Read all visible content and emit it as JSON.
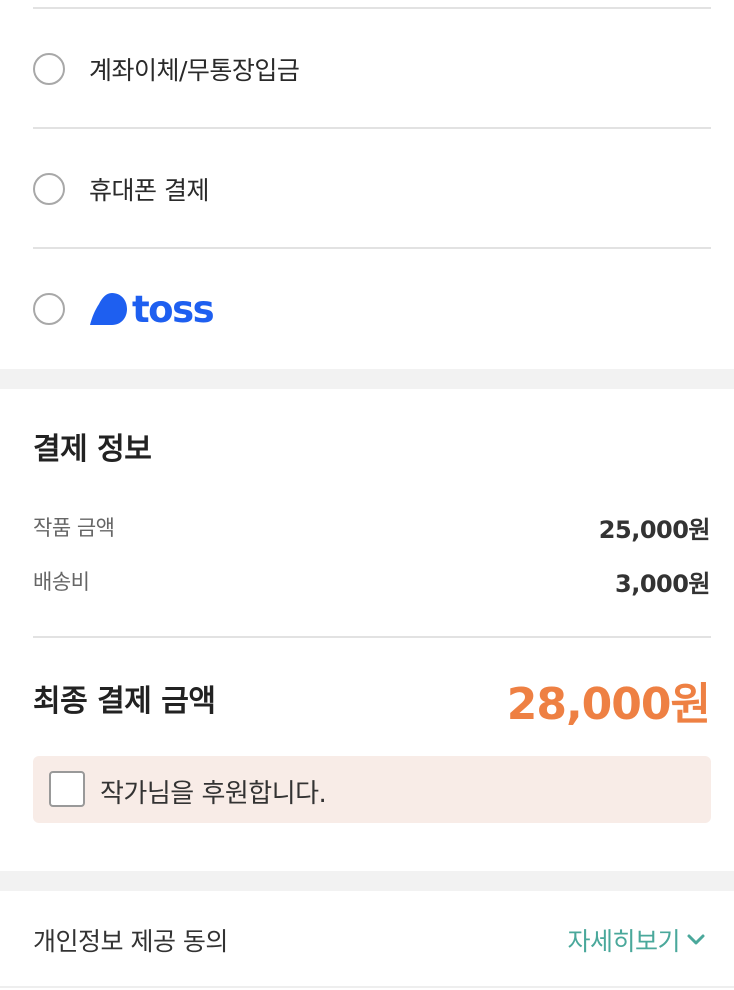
{
  "payment_methods": [
    {
      "label": "계좌이체/무통장입금",
      "selected": false
    },
    {
      "label": "휴대폰 결제",
      "selected": false
    },
    {
      "label": "toss",
      "selected": false
    }
  ],
  "payment_info": {
    "title": "결제 정보",
    "rows": [
      {
        "label": "작품 금액",
        "value": "25,000원"
      },
      {
        "label": "배송비",
        "value": "3,000원"
      }
    ],
    "final_label": "최종 결제 금액",
    "final_value": "28,000원",
    "support_label": "작가님을 후원합니다.",
    "support_checked": false
  },
  "privacy": {
    "label": "개인정보 제공 동의",
    "detail_link": "자세히보기"
  },
  "colors": {
    "accent_orange": "#ee8043",
    "toss_blue": "#1e5ff0",
    "link_teal": "#4aa89b",
    "support_bg": "#f8ece7"
  }
}
